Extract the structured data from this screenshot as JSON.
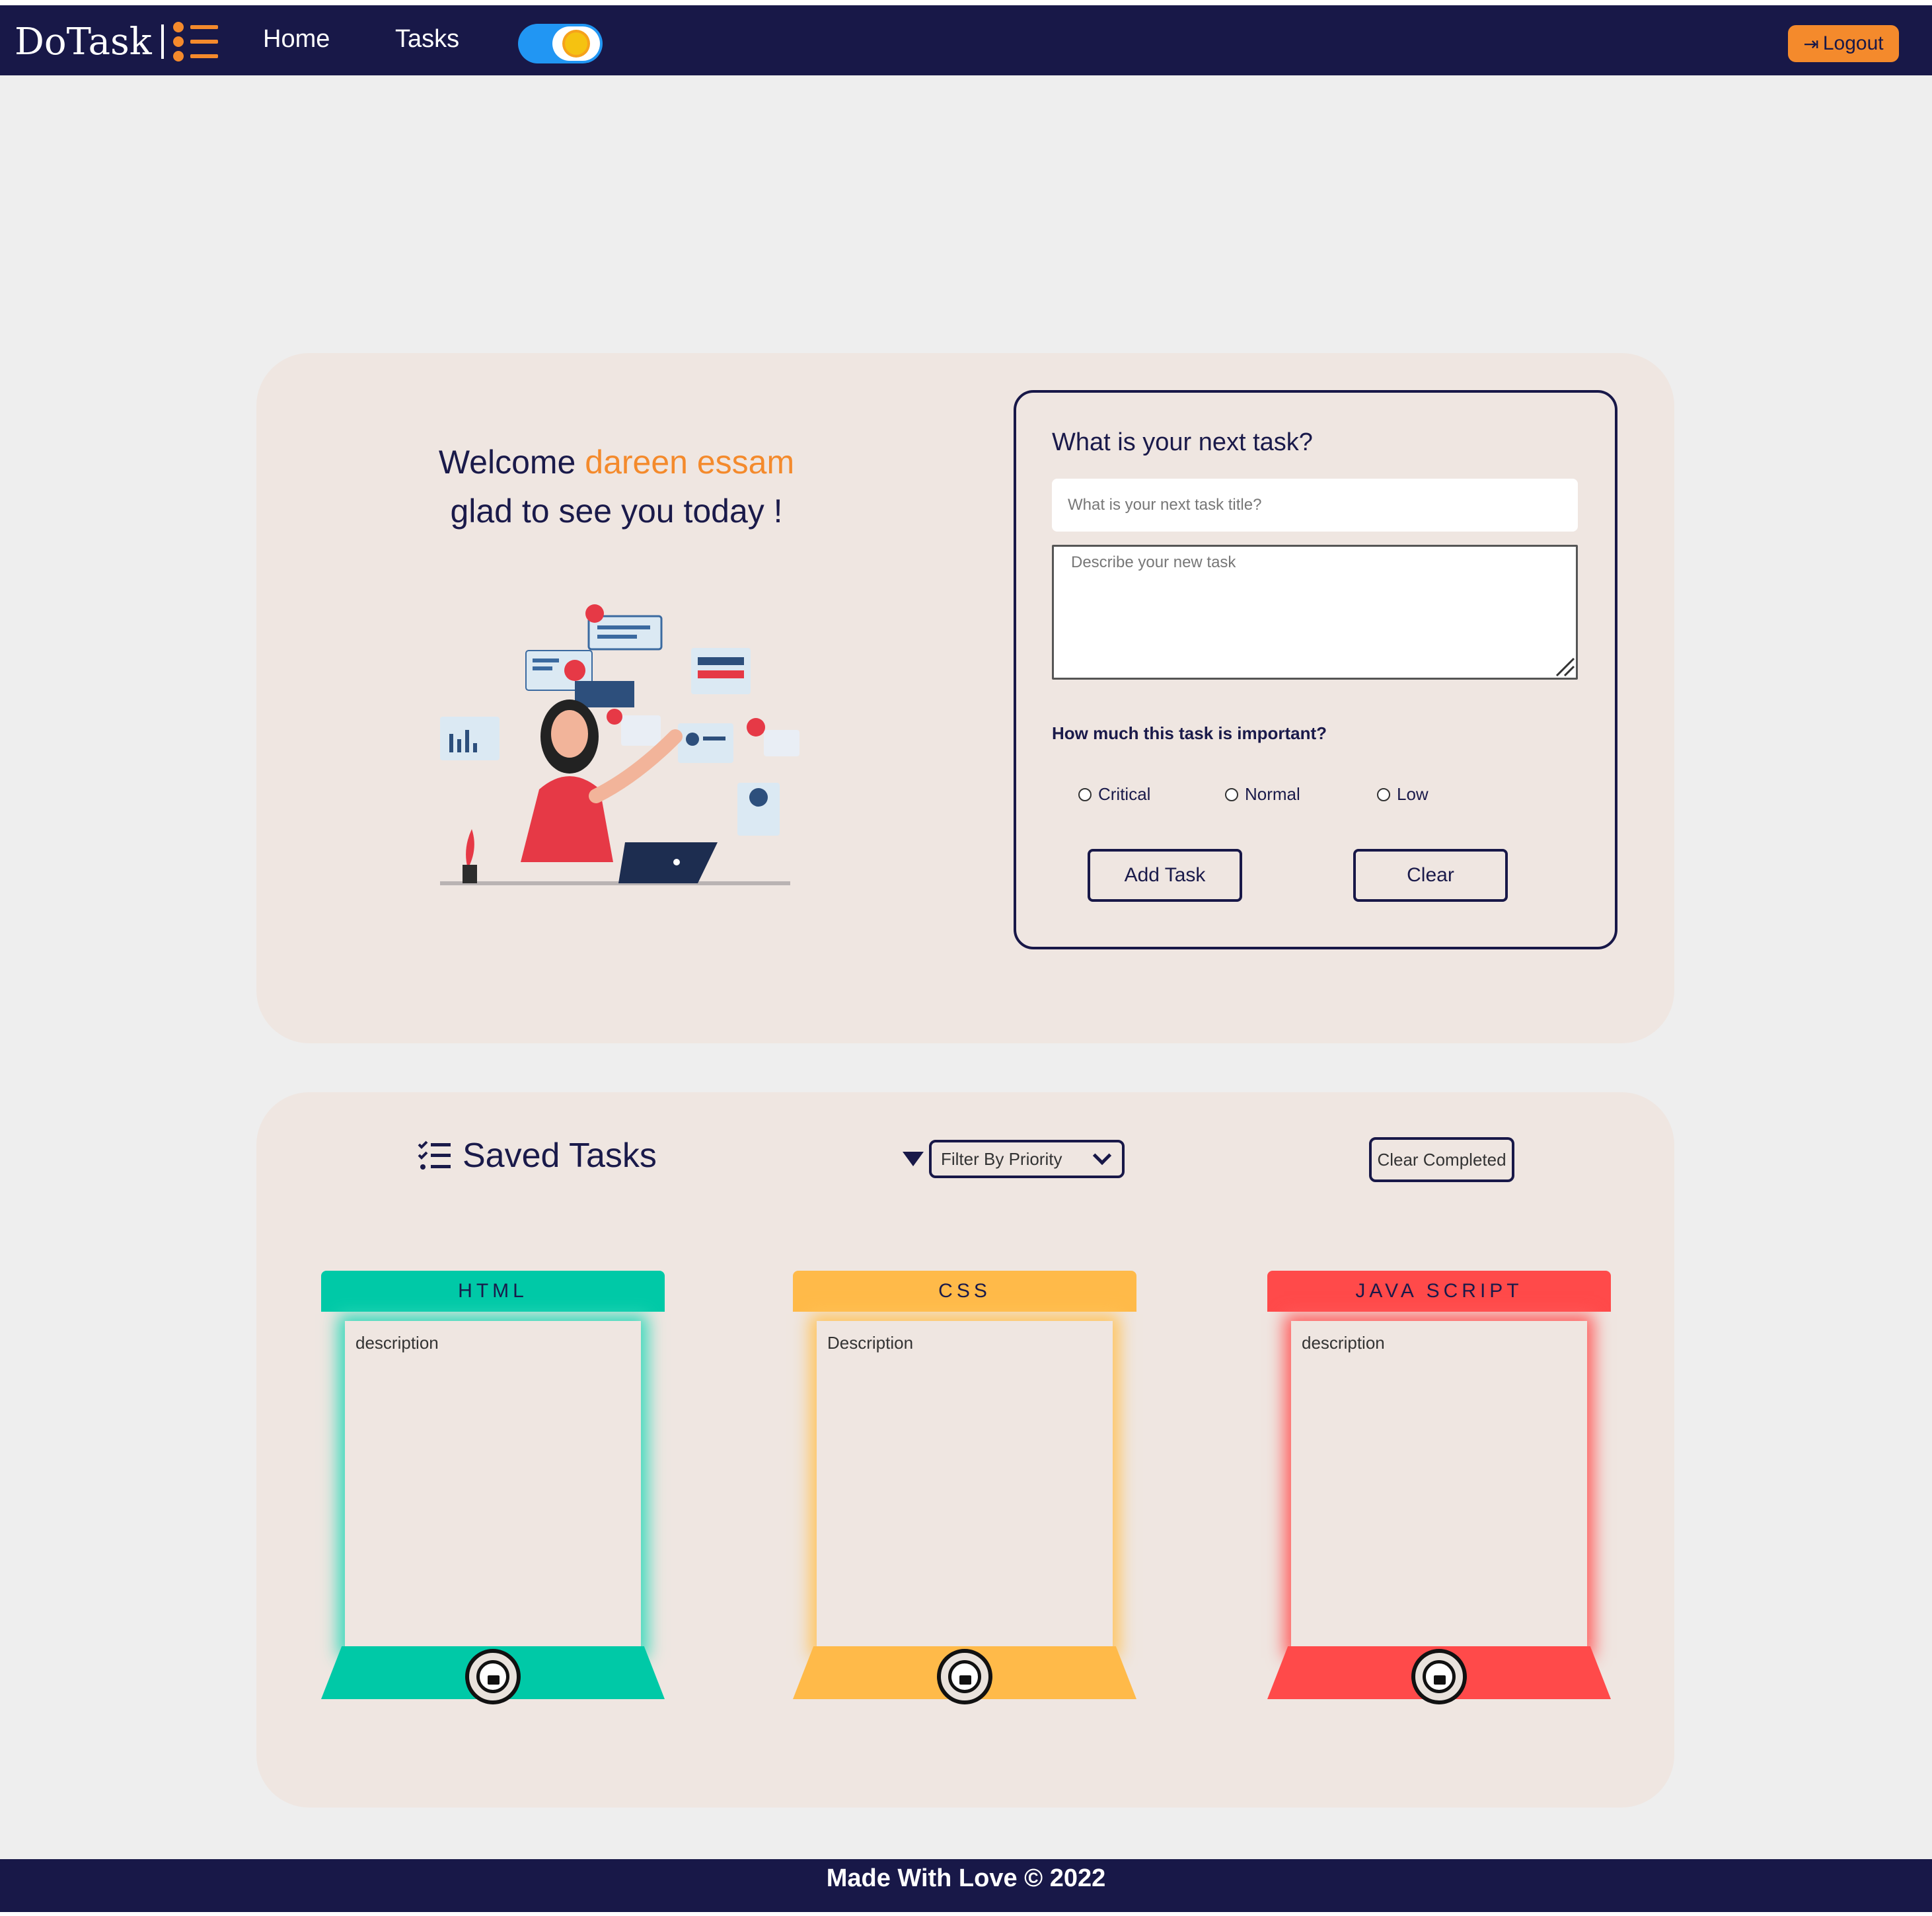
{
  "app": {
    "brand": "DoTask",
    "brand_sep": "|"
  },
  "nav": {
    "home": "Home",
    "tasks": "Tasks",
    "logout": "Logout"
  },
  "colors": {
    "navy": "#181848",
    "accent": "#f48a2c",
    "panel": "#efe6e1",
    "html": "#00c9a7",
    "css": "#ffba49",
    "js": "#ff4a4a",
    "toggle": "#2196f3"
  },
  "hero": {
    "welcome": "Welcome",
    "user_name": "dareen essam",
    "subtitle": "glad to see you today !"
  },
  "form": {
    "title": "What is your next task?",
    "title_placeholder": "What is your next task title?",
    "desc_placeholder": "Describe your new task",
    "importance_label": "How much this task is important?",
    "priorities": [
      "Critical",
      "Normal",
      "Low"
    ],
    "add_button": "Add Task",
    "clear_button": "Clear"
  },
  "saved": {
    "title": "Saved Tasks",
    "filter_placeholder": "Filter By Priority",
    "clear_completed": "Clear Completed",
    "cards": [
      {
        "title": "HTML",
        "description": "description",
        "color": "#00c9a7"
      },
      {
        "title": "CSS",
        "description": "Description",
        "color": "#ffba49"
      },
      {
        "title": "JAVA SCRIPT",
        "description": "description",
        "color": "#ff4a4a"
      }
    ]
  },
  "footer": {
    "text": "Made With Love © 2022"
  },
  "icons": {
    "brand": "task-list-icon",
    "theme": "sun-icon",
    "logout": "sign-out-icon",
    "saved": "list-icon",
    "filter": "funnel-icon",
    "dropdown": "chevron-down-icon",
    "card_badge": "avatar-badge-icon"
  }
}
